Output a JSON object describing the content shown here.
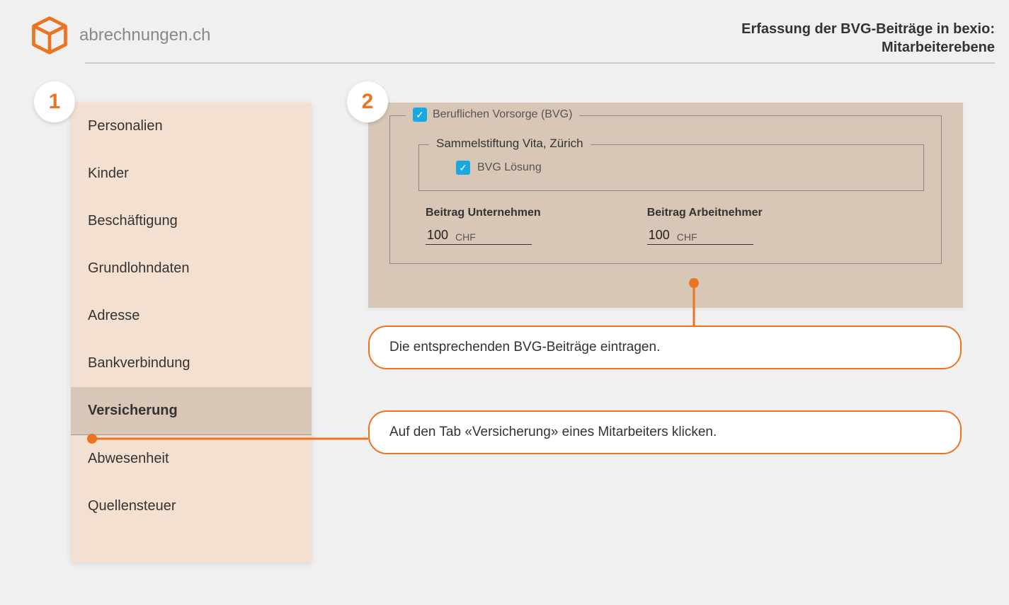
{
  "header": {
    "brand": "abrechnungen.ch",
    "title_line1": "Erfassung der BVG-Beiträge in bexio:",
    "title_line2": "Mitarbeiterebene"
  },
  "steps": {
    "badge1": "1",
    "badge2": "2"
  },
  "sidebar": {
    "items": [
      {
        "label": "Personalien"
      },
      {
        "label": "Kinder"
      },
      {
        "label": "Beschäftigung"
      },
      {
        "label": "Grundlohndaten"
      },
      {
        "label": "Adresse"
      },
      {
        "label": "Bankverbindung"
      },
      {
        "label": "Versicherung",
        "active": true
      },
      {
        "label": "Abwesenheit"
      },
      {
        "label": "Quellensteuer"
      }
    ]
  },
  "form": {
    "bvg_checkbox_label": "Beruflichen Vorsorge (BVG)",
    "foundation_name": "Sammelstiftung Vita, Zürich",
    "solution_checkbox_label": "BVG Lösung",
    "company": {
      "label": "Beitrag Unternehmen",
      "value": "100",
      "unit": "CHF"
    },
    "employee": {
      "label": "Beitrag Arbeitnehmer",
      "value": "100",
      "unit": "CHF"
    }
  },
  "callouts": {
    "c1": "Auf den Tab «Versicherung» eines Mitarbeiters klicken.",
    "c2": "Die entsprechenden BVG-Beiträge eintragen."
  },
  "colors": {
    "accent": "#ed7321",
    "panel_light": "#f4e0d0",
    "panel_dark": "#d8c6b6",
    "checkbox": "#1aa8e0"
  }
}
